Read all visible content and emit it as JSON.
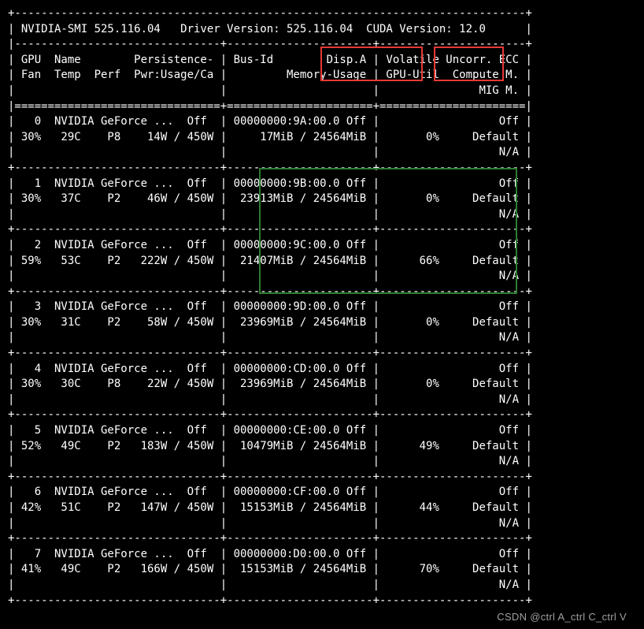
{
  "header": {
    "smi_label": "NVIDIA-SMI",
    "smi_version": "525.116.04",
    "driver_label": "Driver Version:",
    "driver_version": "525.116.04",
    "cuda_label": "CUDA Version:",
    "cuda_version": "12.0"
  },
  "col_headers": {
    "left1": "GPU  Name        Persistence-M",
    "left2": "Fan  Temp  Perf  Pwr:Usage/Cap",
    "mid1": "Bus-Id        Disp.A",
    "mid2": "Memory-Usage",
    "right1": "Volatile Uncorr. ECC",
    "right2": "GPU-Util  Compute M.",
    "right3": "MIG M."
  },
  "gpus": [
    {
      "id": "0",
      "name": "NVIDIA GeForce ...",
      "persist": "Off",
      "fan": "30%",
      "temp": "29C",
      "perf": "P8",
      "pwr": "14W / 450W",
      "bus": "00000000:9A:00.0",
      "disp": "Off",
      "mem": "17MiB / 24564MiB",
      "util": "0%",
      "ecc": "Off",
      "compute": "Default",
      "mig": "N/A"
    },
    {
      "id": "1",
      "name": "NVIDIA GeForce ...",
      "persist": "Off",
      "fan": "30%",
      "temp": "37C",
      "perf": "P2",
      "pwr": "46W / 450W",
      "bus": "00000000:9B:00.0",
      "disp": "Off",
      "mem": "23913MiB / 24564MiB",
      "util": "0%",
      "ecc": "Off",
      "compute": "Default",
      "mig": "N/A"
    },
    {
      "id": "2",
      "name": "NVIDIA GeForce ...",
      "persist": "Off",
      "fan": "59%",
      "temp": "53C",
      "perf": "P2",
      "pwr": "222W / 450W",
      "bus": "00000000:9C:00.0",
      "disp": "Off",
      "mem": "21407MiB / 24564MiB",
      "util": "66%",
      "ecc": "Off",
      "compute": "Default",
      "mig": "N/A"
    },
    {
      "id": "3",
      "name": "NVIDIA GeForce ...",
      "persist": "Off",
      "fan": "30%",
      "temp": "31C",
      "perf": "P2",
      "pwr": "58W / 450W",
      "bus": "00000000:9D:00.0",
      "disp": "Off",
      "mem": "23969MiB / 24564MiB",
      "util": "0%",
      "ecc": "Off",
      "compute": "Default",
      "mig": "N/A"
    },
    {
      "id": "4",
      "name": "NVIDIA GeForce ...",
      "persist": "Off",
      "fan": "30%",
      "temp": "30C",
      "perf": "P8",
      "pwr": "22W / 450W",
      "bus": "00000000:CD:00.0",
      "disp": "Off",
      "mem": "23969MiB / 24564MiB",
      "util": "0%",
      "ecc": "Off",
      "compute": "Default",
      "mig": "N/A"
    },
    {
      "id": "5",
      "name": "NVIDIA GeForce ...",
      "persist": "Off",
      "fan": "52%",
      "temp": "49C",
      "perf": "P2",
      "pwr": "183W / 450W",
      "bus": "00000000:CE:00.0",
      "disp": "Off",
      "mem": "10479MiB / 24564MiB",
      "util": "49%",
      "ecc": "Off",
      "compute": "Default",
      "mig": "N/A"
    },
    {
      "id": "6",
      "name": "NVIDIA GeForce ...",
      "persist": "Off",
      "fan": "42%",
      "temp": "51C",
      "perf": "P2",
      "pwr": "147W / 450W",
      "bus": "00000000:CF:00.0",
      "disp": "Off",
      "mem": "15153MiB / 24564MiB",
      "util": "44%",
      "ecc": "Off",
      "compute": "Default",
      "mig": "N/A"
    },
    {
      "id": "7",
      "name": "NVIDIA GeForce ...",
      "persist": "Off",
      "fan": "41%",
      "temp": "49C",
      "perf": "P2",
      "pwr": "166W / 450W",
      "bus": "00000000:D0:00.0",
      "disp": "Off",
      "mem": "15153MiB / 24564MiB",
      "util": "70%",
      "ecc": "Off",
      "compute": "Default",
      "mig": "N/A"
    }
  ],
  "watermark": "CSDN @ctrl A_ctrl C_ctrl V",
  "highlights": {
    "mem_header": true,
    "util_header": true,
    "rows_1_2": true
  }
}
